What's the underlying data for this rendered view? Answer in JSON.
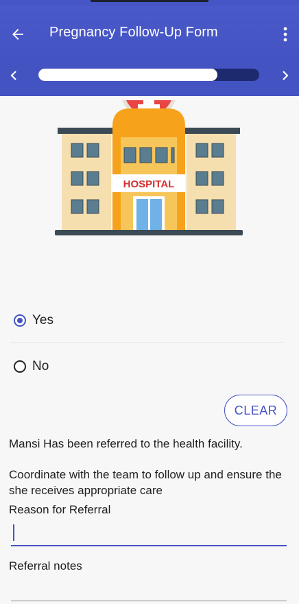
{
  "header": {
    "title": "Pregnancy Follow-Up Form"
  },
  "progress": {
    "value": 0.81
  },
  "illustration": {
    "sign_text": "HOSPITAL"
  },
  "options": [
    {
      "label": "Yes",
      "selected": true
    },
    {
      "label": "No",
      "selected": false
    }
  ],
  "clear_label": "CLEAR",
  "messages": {
    "referred": "Mansi Has been referred to the health facility.",
    "coordinate": "Coordinate with the team to follow up and ensure the she receives appropriate care"
  },
  "fields": {
    "reason_label": "Reason for Referral",
    "notes_label": "Referral notes"
  },
  "colors": {
    "primary": "#4453c2",
    "progress_track": "#1d2a6e"
  }
}
